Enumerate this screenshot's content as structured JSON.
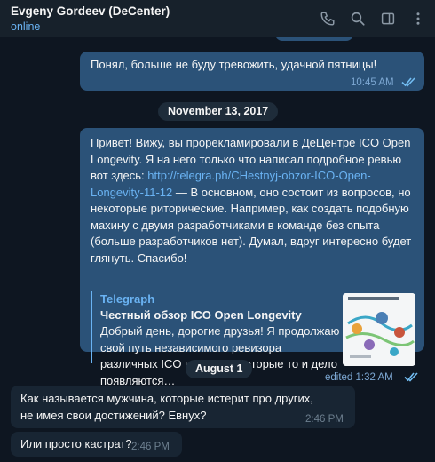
{
  "header": {
    "name": "Evgeny Gordeev (DeCenter)",
    "status": "online"
  },
  "messages": {
    "m1": {
      "text": "Понял, больше не буду тревожить, удачной пятницы!",
      "time": "10:45 AM"
    },
    "date1": "November 13, 2017",
    "m2": {
      "text_before": "Привет! Вижу, вы прорекламировали в ДеЦентре ICO Open Longevity. Я на него только что написал подробное ревью вот здесь: ",
      "link": "http://telegra.ph/CHestnyj-obzor-ICO-Open-Longevity-11-12",
      "text_after": " — В основном, оно состоит из вопросов, но некоторые риторические. Например, как создать подобную махину с двумя разработчиками в команде без опыта (больше разработчиков нет). Думал, вдруг интересно будет глянуть. Спасибо!",
      "preview_site": "Telegraph",
      "preview_title": "Честный обзор ICO Open Longevity",
      "preview_desc": "Добрый день, дорогие друзья! Я продолжаю свой путь независимого ревизора различных ICO проектов, которые то и дело появляются…",
      "time": "edited 1:32 AM"
    },
    "date2": "August 1",
    "m3": {
      "text": "Как называется мужчина, которые истерит про других, не имея свои достижений? Евнух?",
      "time": "2:46 PM"
    },
    "m4": {
      "text": "Или просто кастрат?",
      "time": "2:46 PM"
    }
  },
  "icons": [
    "phone-icon",
    "search-icon",
    "sidebar-toggle-icon",
    "more-vertical-icon",
    "double-check-icon"
  ],
  "colors": {
    "background": "#0e1621",
    "header": "#17212b",
    "outgoing": "#2b5278",
    "incoming": "#182533",
    "accent": "#6ab3f3"
  }
}
